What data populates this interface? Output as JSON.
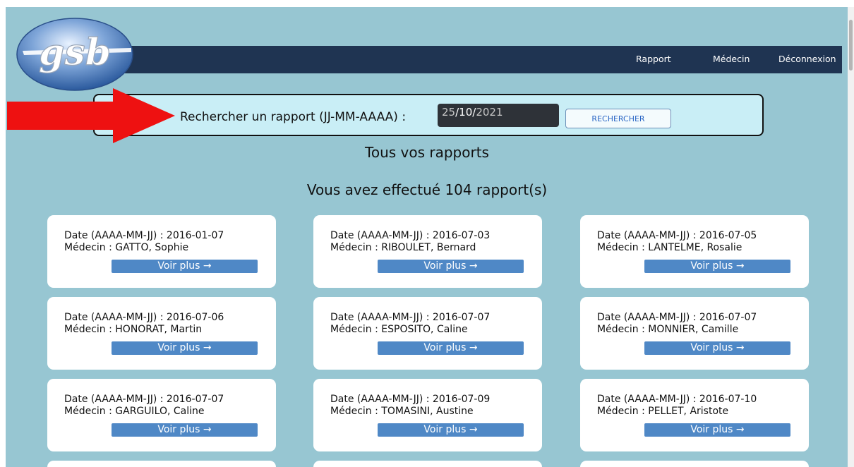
{
  "nav": {
    "logo_text": "gsb",
    "links": [
      "Rapport",
      "Médecin",
      "Déconnexion"
    ]
  },
  "search": {
    "label": "Rechercher un rapport (JJ-MM-AAAA) :",
    "date_day": "25",
    "date_month": "10",
    "date_year": "2021",
    "button_label": "RECHERCHER"
  },
  "headings": {
    "all_reports": "Tous vos rapports",
    "count_text": "Vous avez effectué 104 rapport(s)"
  },
  "cards": [
    {
      "date": "Date (AAAA-MM-JJ) : 2016-01-07",
      "medecin": "Médecin : GATTO, Sophie",
      "button": "Voir plus →"
    },
    {
      "date": "Date (AAAA-MM-JJ) : 2016-07-03",
      "medecin": "Médecin : RIBOULET, Bernard",
      "button": "Voir plus →"
    },
    {
      "date": "Date (AAAA-MM-JJ) : 2016-07-05",
      "medecin": "Médecin : LANTELME, Rosalie",
      "button": "Voir plus →"
    },
    {
      "date": "Date (AAAA-MM-JJ) : 2016-07-06",
      "medecin": "Médecin : HONORAT, Martin",
      "button": "Voir plus →"
    },
    {
      "date": "Date (AAAA-MM-JJ) : 2016-07-07",
      "medecin": "Médecin : ESPOSITO, Caline",
      "button": "Voir plus →"
    },
    {
      "date": "Date (AAAA-MM-JJ) : 2016-07-07",
      "medecin": "Médecin : MONNIER, Camille",
      "button": "Voir plus →"
    },
    {
      "date": "Date (AAAA-MM-JJ) : 2016-07-07",
      "medecin": "Médecin : GARGUILO, Caline",
      "button": "Voir plus →"
    },
    {
      "date": "Date (AAAA-MM-JJ) : 2016-07-09",
      "medecin": "Médecin : TOMASINI, Austine",
      "button": "Voir plus →"
    },
    {
      "date": "Date (AAAA-MM-JJ) : 2016-07-10",
      "medecin": "Médecin : PELLET, Aristote",
      "button": "Voir plus →"
    }
  ],
  "colors": {
    "page_background": "#97c6d2",
    "navbar": "#1f3452",
    "search_box": "#c9eef6",
    "card_button": "#4f88c6",
    "annotation_arrow": "#ee1111"
  },
  "icons": {
    "annotation": "red-arrow-icon",
    "button_arrow": "right-arrow-icon"
  }
}
